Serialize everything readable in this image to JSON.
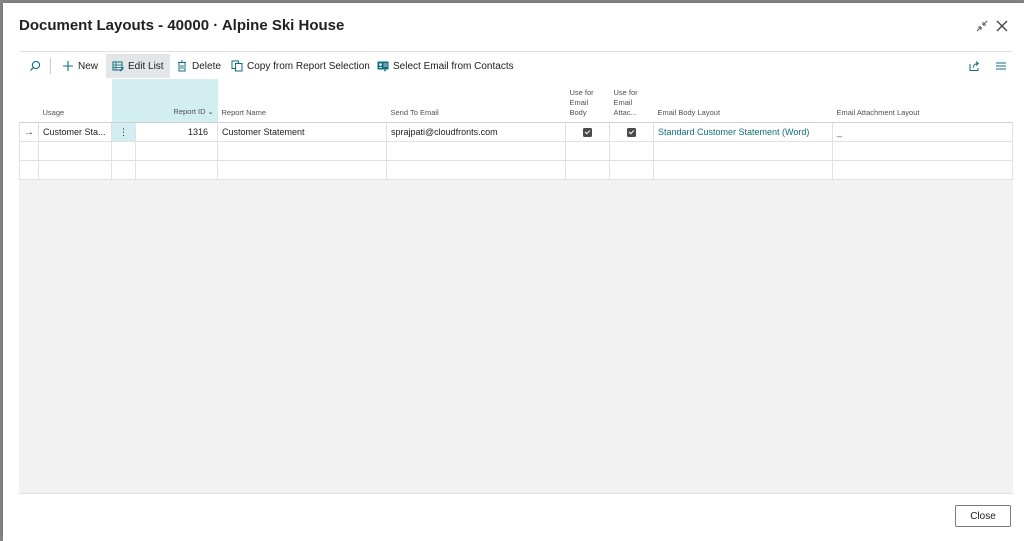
{
  "dialog": {
    "title": "Document Layouts - 40000 · Alpine Ski House",
    "close_label": "Close"
  },
  "icons": {
    "collapse": "collapse-icon",
    "close": "close-icon",
    "search": "search-icon",
    "new": "plus-icon",
    "edit_list": "edit-list-icon",
    "delete": "trash-icon",
    "copy": "copy-icon",
    "email": "contact-email-icon",
    "share": "share-icon",
    "list_view": "list-view-icon"
  },
  "toolbar": {
    "new_label": "New",
    "edit_list_label": "Edit List",
    "delete_label": "Delete",
    "copy_label": "Copy from Report Selection",
    "email_label": "Select Email from Contacts"
  },
  "columns": {
    "usage": "Usage",
    "report_id": "Report ID",
    "report_name": "Report Name",
    "send_to_email": "Send To Email",
    "use_email_body_1": "Use for",
    "use_email_body_2": "Email",
    "use_email_body_3": "Body",
    "use_email_attach_1": "Use for",
    "use_email_attach_2": "Email",
    "use_email_attach_3": "Attac...",
    "email_body_layout": "Email Body Layout",
    "email_attachment_layout": "Email Attachment Layout"
  },
  "rows": [
    {
      "usage": "Customer Sta...",
      "report_id": "1316",
      "report_name": "Customer Statement",
      "send_to_email": "sprajpati@cloudfronts.com",
      "use_for_email_body": true,
      "use_for_email_attachment": true,
      "email_body_layout": "Standard Customer Statement (Word)",
      "email_attachment_layout": "_"
    }
  ],
  "colors": {
    "accent_highlight": "#d3eef0",
    "link": "#0f6e7e",
    "toolbar_selected": "#e3e6e9"
  }
}
